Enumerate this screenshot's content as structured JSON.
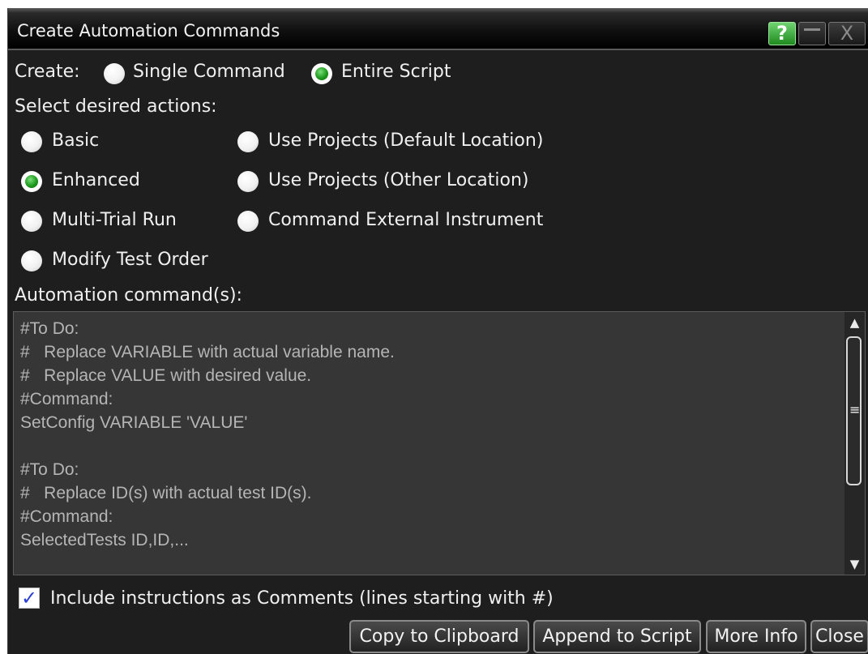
{
  "window": {
    "title": "Create Automation Commands"
  },
  "titlebar": {
    "help_label": "?",
    "close_label": "X"
  },
  "create": {
    "label": "Create:",
    "options": [
      {
        "label": "Single Command",
        "selected": false
      },
      {
        "label": "Entire Script",
        "selected": true
      }
    ]
  },
  "actions": {
    "label": "Select desired actions:",
    "options": [
      {
        "label": "Basic",
        "selected": false
      },
      {
        "label": "Enhanced",
        "selected": true
      },
      {
        "label": "Multi-Trial Run",
        "selected": false
      },
      {
        "label": "Modify Test Order",
        "selected": false
      },
      {
        "label": "Use Projects (Default Location)",
        "selected": false
      },
      {
        "label": "Use Projects (Other Location)",
        "selected": false
      },
      {
        "label": "Command External Instrument",
        "selected": false
      }
    ]
  },
  "commands": {
    "label": "Automation command(s):",
    "text": "#To Do:\n#   Replace VARIABLE with actual variable name.\n#   Replace VALUE with desired value.\n#Command:\nSetConfig VARIABLE 'VALUE'\n\n#To Do:\n#   Replace ID(s) with actual test ID(s).\n#Command:\nSelectedTests ID,ID,..."
  },
  "scrollbar": {
    "up_glyph": "▲",
    "down_glyph": "▼",
    "thumb_glyph": "≡"
  },
  "include_comments": {
    "checked": true,
    "check_glyph": "✓",
    "label": "Include instructions as Comments (lines starting with #)"
  },
  "buttons": {
    "copy": "Copy to Clipboard",
    "append": "Append to Script",
    "more_info": "More Info",
    "close": "Close"
  },
  "colors": {
    "accent_green": "#1e9a1e",
    "check_blue": "#2a3fd6",
    "background": "#1e1e1e"
  }
}
